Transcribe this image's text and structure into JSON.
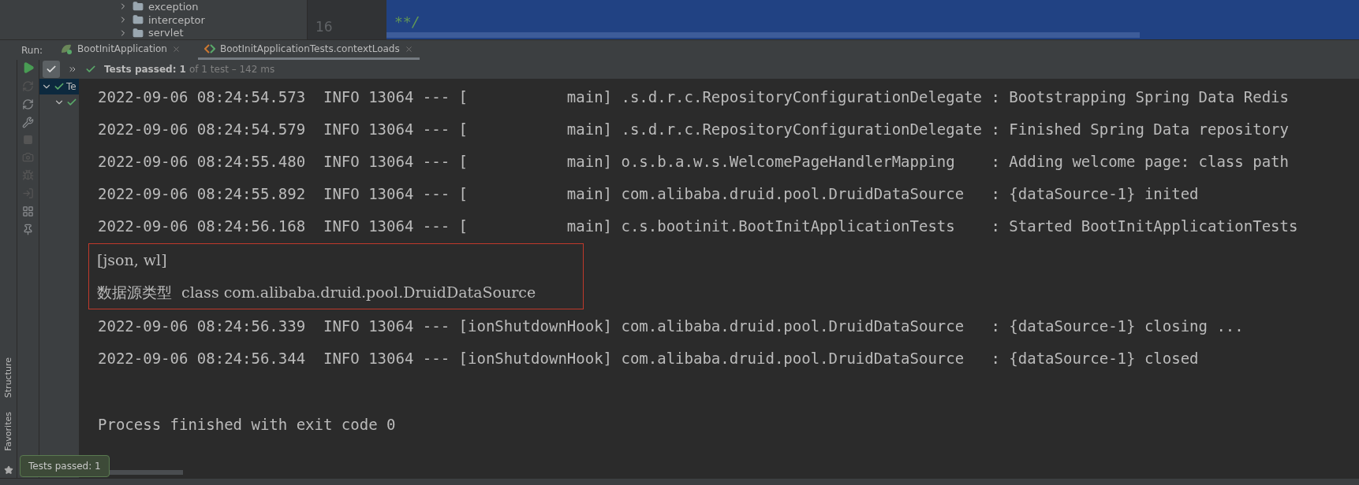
{
  "project_tree": {
    "items": [
      {
        "label": "exception",
        "expanded": false
      },
      {
        "label": "interceptor",
        "expanded": false
      },
      {
        "label": "servlet",
        "expanded": false
      }
    ]
  },
  "editor": {
    "line_number": "16",
    "code": "**/"
  },
  "run_panel": {
    "label": "Run:",
    "tabs": [
      {
        "label": "BootInitApplication",
        "kind": "app",
        "selected": false
      },
      {
        "label": "BootInitApplicationTests.contextLoads",
        "kind": "test",
        "selected": true
      }
    ],
    "show_passed_toggle": {
      "on": true
    },
    "status": {
      "passed": "Tests passed: 1",
      "detail": "of 1 test – 142 ms"
    },
    "test_tree": [
      {
        "label": "Te",
        "passed": true,
        "expanded": true,
        "selected": true,
        "children": [
          {
            "passed": true,
            "expanded": true,
            "selected": false
          }
        ]
      }
    ]
  },
  "console": {
    "blocks": [
      {
        "kind": "log",
        "highlighted": false,
        "lines": [
          "2022-09-06 08:24:54.573  INFO 13064 --- [           main] .s.d.r.c.RepositoryConfigurationDelegate : Bootstrapping Spring Data Redis",
          "2022-09-06 08:24:54.579  INFO 13064 --- [           main] .s.d.r.c.RepositoryConfigurationDelegate : Finished Spring Data repository",
          "2022-09-06 08:24:55.480  INFO 13064 --- [           main] o.s.b.a.w.s.WelcomePageHandlerMapping    : Adding welcome page: class path",
          "2022-09-06 08:24:55.892  INFO 13064 --- [           main] com.alibaba.druid.pool.DruidDataSource   : {dataSource-1} inited",
          "2022-09-06 08:24:56.168  INFO 13064 --- [           main] c.s.bootinit.BootInitApplicationTests    : Started BootInitApplicationTests"
        ]
      },
      {
        "kind": "output",
        "highlighted": true,
        "lines": [
          "[json, wl]",
          "数据源类型  class com.alibaba.druid.pool.DruidDataSource"
        ]
      },
      {
        "kind": "log",
        "highlighted": false,
        "lines": [
          "2022-09-06 08:24:56.339  INFO 13064 --- [ionShutdownHook] com.alibaba.druid.pool.DruidDataSource   : {dataSource-1} closing ...",
          "2022-09-06 08:24:56.344  INFO 13064 --- [ionShutdownHook] com.alibaba.druid.pool.DruidDataSource   : {dataSource-1} closed"
        ]
      },
      {
        "kind": "exit",
        "highlighted": false,
        "lines": [
          "Process finished with exit code 0"
        ]
      }
    ]
  },
  "side_tabs": [
    "Structure",
    "Favorites"
  ],
  "tooltip": "Tests passed: 1"
}
